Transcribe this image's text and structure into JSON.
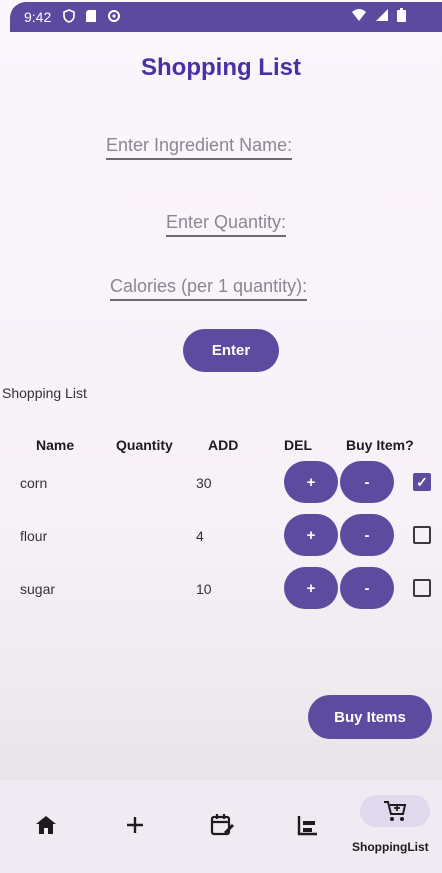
{
  "status_bar": {
    "time": "9:42",
    "icons": [
      "shield-icon",
      "sd-card-icon",
      "sync-icon"
    ],
    "right_icons": [
      "wifi-icon",
      "signal-icon",
      "battery-icon"
    ]
  },
  "title": "Shopping List",
  "form": {
    "ingredient_placeholder": "Enter Ingredient Name:",
    "quantity_placeholder": "Enter Quantity:",
    "calories_placeholder": "Calories (per 1 quantity):",
    "enter_label": "Enter"
  },
  "section_label": "Shopping List",
  "table": {
    "headers": [
      "Name",
      "Quantity",
      "ADD",
      "DEL",
      "Buy Item?"
    ],
    "rows": [
      {
        "name": "corn",
        "quantity": "30",
        "add_label": "+",
        "del_label": "-",
        "buy": true
      },
      {
        "name": "flour",
        "quantity": "4",
        "add_label": "+",
        "del_label": "-",
        "buy": false
      },
      {
        "name": "sugar",
        "quantity": "10",
        "add_label": "+",
        "del_label": "-",
        "buy": false
      }
    ]
  },
  "buy_button_label": "Buy Items",
  "nav": {
    "items": [
      {
        "icon": "home-icon"
      },
      {
        "icon": "add-icon"
      },
      {
        "icon": "calendar-edit-icon"
      },
      {
        "icon": "chart-icon"
      },
      {
        "icon": "shopping-cart-icon",
        "label": "ShoppingList",
        "active": true
      }
    ]
  },
  "colors": {
    "accent": "#5d4b9f",
    "title": "#4a2fa6",
    "status_bar": "#5b4a9e"
  }
}
